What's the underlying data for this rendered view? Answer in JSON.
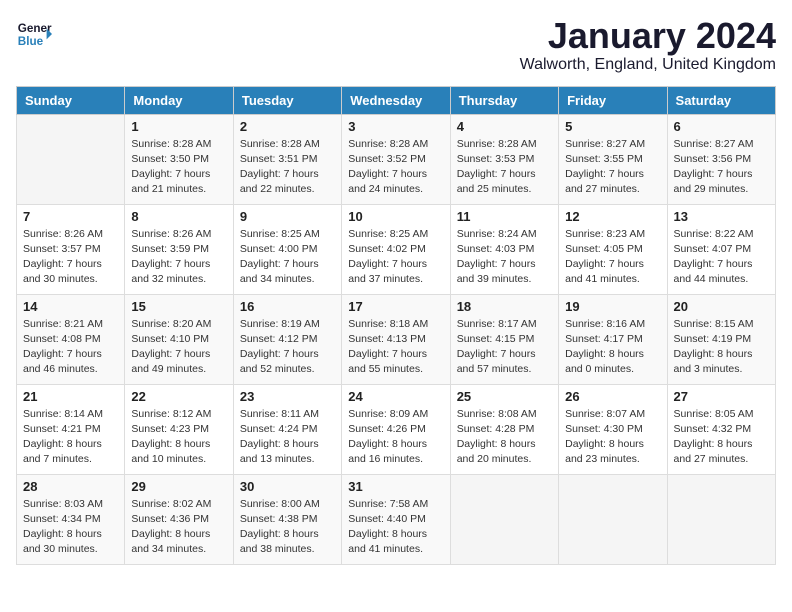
{
  "logo": {
    "line1": "General",
    "line2": "Blue",
    "arrow_color": "#2980b9"
  },
  "header": {
    "month": "January 2024",
    "location": "Walworth, England, United Kingdom"
  },
  "days_of_week": [
    "Sunday",
    "Monday",
    "Tuesday",
    "Wednesday",
    "Thursday",
    "Friday",
    "Saturday"
  ],
  "weeks": [
    [
      {
        "day": "",
        "info": ""
      },
      {
        "day": "1",
        "info": "Sunrise: 8:28 AM\nSunset: 3:50 PM\nDaylight: 7 hours\nand 21 minutes."
      },
      {
        "day": "2",
        "info": "Sunrise: 8:28 AM\nSunset: 3:51 PM\nDaylight: 7 hours\nand 22 minutes."
      },
      {
        "day": "3",
        "info": "Sunrise: 8:28 AM\nSunset: 3:52 PM\nDaylight: 7 hours\nand 24 minutes."
      },
      {
        "day": "4",
        "info": "Sunrise: 8:28 AM\nSunset: 3:53 PM\nDaylight: 7 hours\nand 25 minutes."
      },
      {
        "day": "5",
        "info": "Sunrise: 8:27 AM\nSunset: 3:55 PM\nDaylight: 7 hours\nand 27 minutes."
      },
      {
        "day": "6",
        "info": "Sunrise: 8:27 AM\nSunset: 3:56 PM\nDaylight: 7 hours\nand 29 minutes."
      }
    ],
    [
      {
        "day": "7",
        "info": "Sunrise: 8:26 AM\nSunset: 3:57 PM\nDaylight: 7 hours\nand 30 minutes."
      },
      {
        "day": "8",
        "info": "Sunrise: 8:26 AM\nSunset: 3:59 PM\nDaylight: 7 hours\nand 32 minutes."
      },
      {
        "day": "9",
        "info": "Sunrise: 8:25 AM\nSunset: 4:00 PM\nDaylight: 7 hours\nand 34 minutes."
      },
      {
        "day": "10",
        "info": "Sunrise: 8:25 AM\nSunset: 4:02 PM\nDaylight: 7 hours\nand 37 minutes."
      },
      {
        "day": "11",
        "info": "Sunrise: 8:24 AM\nSunset: 4:03 PM\nDaylight: 7 hours\nand 39 minutes."
      },
      {
        "day": "12",
        "info": "Sunrise: 8:23 AM\nSunset: 4:05 PM\nDaylight: 7 hours\nand 41 minutes."
      },
      {
        "day": "13",
        "info": "Sunrise: 8:22 AM\nSunset: 4:07 PM\nDaylight: 7 hours\nand 44 minutes."
      }
    ],
    [
      {
        "day": "14",
        "info": "Sunrise: 8:21 AM\nSunset: 4:08 PM\nDaylight: 7 hours\nand 46 minutes."
      },
      {
        "day": "15",
        "info": "Sunrise: 8:20 AM\nSunset: 4:10 PM\nDaylight: 7 hours\nand 49 minutes."
      },
      {
        "day": "16",
        "info": "Sunrise: 8:19 AM\nSunset: 4:12 PM\nDaylight: 7 hours\nand 52 minutes."
      },
      {
        "day": "17",
        "info": "Sunrise: 8:18 AM\nSunset: 4:13 PM\nDaylight: 7 hours\nand 55 minutes."
      },
      {
        "day": "18",
        "info": "Sunrise: 8:17 AM\nSunset: 4:15 PM\nDaylight: 7 hours\nand 57 minutes."
      },
      {
        "day": "19",
        "info": "Sunrise: 8:16 AM\nSunset: 4:17 PM\nDaylight: 8 hours\nand 0 minutes."
      },
      {
        "day": "20",
        "info": "Sunrise: 8:15 AM\nSunset: 4:19 PM\nDaylight: 8 hours\nand 3 minutes."
      }
    ],
    [
      {
        "day": "21",
        "info": "Sunrise: 8:14 AM\nSunset: 4:21 PM\nDaylight: 8 hours\nand 7 minutes."
      },
      {
        "day": "22",
        "info": "Sunrise: 8:12 AM\nSunset: 4:23 PM\nDaylight: 8 hours\nand 10 minutes."
      },
      {
        "day": "23",
        "info": "Sunrise: 8:11 AM\nSunset: 4:24 PM\nDaylight: 8 hours\nand 13 minutes."
      },
      {
        "day": "24",
        "info": "Sunrise: 8:09 AM\nSunset: 4:26 PM\nDaylight: 8 hours\nand 16 minutes."
      },
      {
        "day": "25",
        "info": "Sunrise: 8:08 AM\nSunset: 4:28 PM\nDaylight: 8 hours\nand 20 minutes."
      },
      {
        "day": "26",
        "info": "Sunrise: 8:07 AM\nSunset: 4:30 PM\nDaylight: 8 hours\nand 23 minutes."
      },
      {
        "day": "27",
        "info": "Sunrise: 8:05 AM\nSunset: 4:32 PM\nDaylight: 8 hours\nand 27 minutes."
      }
    ],
    [
      {
        "day": "28",
        "info": "Sunrise: 8:03 AM\nSunset: 4:34 PM\nDaylight: 8 hours\nand 30 minutes."
      },
      {
        "day": "29",
        "info": "Sunrise: 8:02 AM\nSunset: 4:36 PM\nDaylight: 8 hours\nand 34 minutes."
      },
      {
        "day": "30",
        "info": "Sunrise: 8:00 AM\nSunset: 4:38 PM\nDaylight: 8 hours\nand 38 minutes."
      },
      {
        "day": "31",
        "info": "Sunrise: 7:58 AM\nSunset: 4:40 PM\nDaylight: 8 hours\nand 41 minutes."
      },
      {
        "day": "",
        "info": ""
      },
      {
        "day": "",
        "info": ""
      },
      {
        "day": "",
        "info": ""
      }
    ]
  ]
}
